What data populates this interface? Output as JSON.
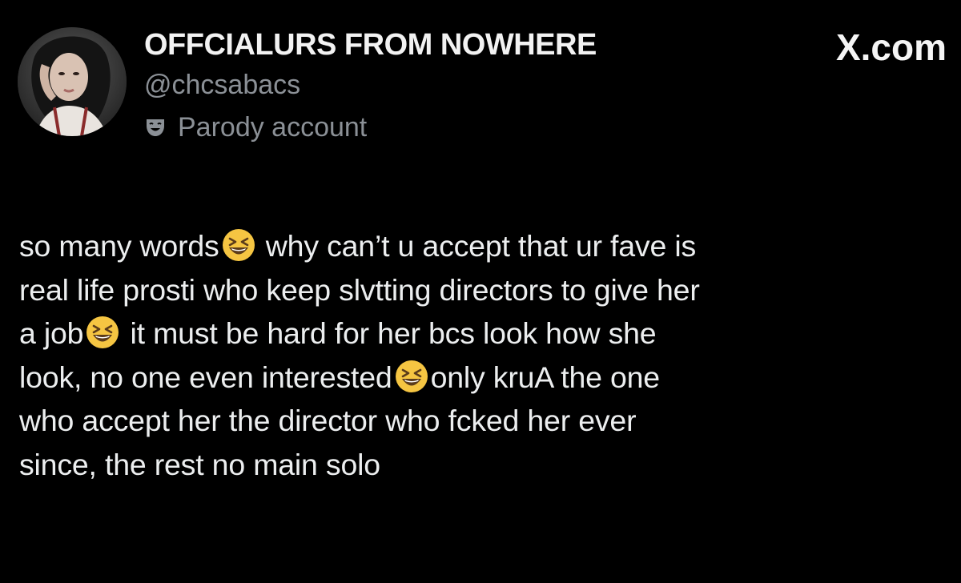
{
  "header": {
    "display_name": "OFFCIALURS FROM NOWHERE",
    "handle": "@chcsabacs",
    "badge": {
      "icon": "theater-mask-icon",
      "label": "Parody account"
    },
    "brand": "X.com"
  },
  "post": {
    "emoji_name": "grinning-squinting-face-emoji",
    "text": {
      "l1a": "so many words",
      "l1b": " why can’t u accept that ur fave is",
      "l2": "real life prosti who keep slvtting directors to give her",
      "l3a": "a job",
      "l3b": " it must be hard for her bcs look how she",
      "l4a": "look, no one even interested",
      "l4b": "only kruA the one",
      "l5": "who accept her the director who fcked her ever",
      "l6": "since, the rest no main solo"
    }
  },
  "colors": {
    "background": "#000000",
    "primary_text": "#e7e9ea",
    "secondary_text": "#8b9096",
    "emoji_face": "#f5c542"
  }
}
